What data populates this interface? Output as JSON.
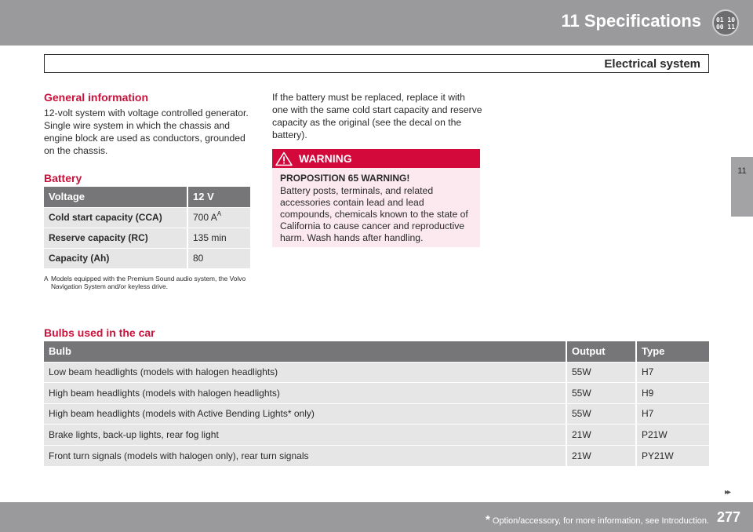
{
  "header": {
    "chapter_title": "11 Specifications",
    "badge_line1": "01 10",
    "badge_line2": "00 11",
    "section_title": "Electrical system"
  },
  "side_tab": {
    "label": "11"
  },
  "general_info": {
    "heading": "General information",
    "text": "12-volt system with voltage controlled generator. Single wire system in which the chassis and engine block are used as conductors, grounded on the chassis."
  },
  "battery": {
    "heading": "Battery",
    "header": {
      "label": "Voltage",
      "value": "12 V"
    },
    "rows": [
      {
        "label": "Cold start capacity (CCA)",
        "value": "700 A",
        "note_mark": "A"
      },
      {
        "label": "Reserve capacity (RC)",
        "value": "135 min"
      },
      {
        "label": "Capacity (Ah)",
        "value": "80"
      }
    ],
    "footnote_mark": "A",
    "footnote_text": "Models equipped with the Premium Sound audio system, the Volvo Navigation System and/or keyless drive."
  },
  "replacement": {
    "text": "If the battery must be replaced, replace it with one with the same cold start capacity and reserve capacity as the original (see the decal on the battery)."
  },
  "warning": {
    "title": "WARNING",
    "subtitle": "PROPOSITION 65 WARNING!",
    "text": "Battery posts, terminals, and related accessories contain lead and lead compounds, chemicals known to the state of California to cause cancer and reproductive harm. Wash hands after handling.",
    "icon": "warning-triangle-icon",
    "accent_color": "#d2093a"
  },
  "bulbs": {
    "heading": "Bulbs used in the car",
    "columns": [
      "Bulb",
      "Output",
      "Type"
    ],
    "rows": [
      [
        "Low beam headlights (models with halogen headlights)",
        "55W",
        "H7"
      ],
      [
        "High beam headlights (models with halogen headlights)",
        "55W",
        "H9"
      ],
      [
        "High beam headlights (models with Active Bending Lights* only)",
        "55W",
        "H7"
      ],
      [
        "Brake lights, back-up lights, rear fog light",
        "21W",
        "P21W"
      ],
      [
        "Front turn signals (models with halogen only), rear turn signals",
        "21W",
        "PY21W"
      ]
    ]
  },
  "footer": {
    "star": "*",
    "note": "Option/accessory, for more information, see Introduction.",
    "page_number": "277",
    "next_arrows": "▸▸"
  },
  "colors": {
    "header_gray": "#9a9a9c",
    "table_header": "#767678",
    "row_bg": "#e6e6e6",
    "heading_red": "#c8123c"
  }
}
